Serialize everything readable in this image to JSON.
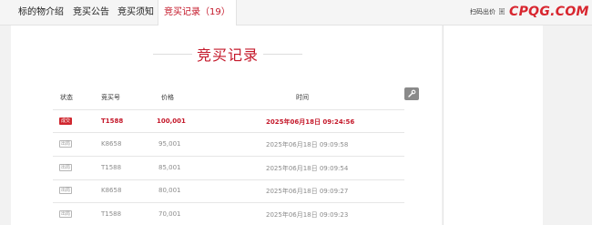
{
  "tabs": [
    {
      "label": "标的物介绍",
      "active": false
    },
    {
      "label": "竞买公告",
      "active": false
    },
    {
      "label": "竞买须知",
      "active": false
    },
    {
      "label": "竞买记录（19）",
      "active": true
    }
  ],
  "header": {
    "scan_text": "扫码出价",
    "qr_icon": "qr-code-icon",
    "brand_logo": "CPQG.COM"
  },
  "section": {
    "title": "竞买记录"
  },
  "settings_icon": "wrench-icon",
  "table": {
    "columns": [
      "状态",
      "竞买号",
      "价格",
      "时间"
    ],
    "rows": [
      {
        "status": "成交",
        "status_type": "winner",
        "bidder": "T1588",
        "price": "100,001",
        "time": "2025年06月18日 09:24:56"
      },
      {
        "status": "出局",
        "status_type": "outbid",
        "bidder": "K8658",
        "price": "95,001",
        "time": "2025年06月18日 09:09:58"
      },
      {
        "status": "出局",
        "status_type": "outbid",
        "bidder": "T1588",
        "price": "85,001",
        "time": "2025年06月18日 09:09:54"
      },
      {
        "status": "出局",
        "status_type": "outbid",
        "bidder": "K8658",
        "price": "80,001",
        "time": "2025年06月18日 09:09:27"
      },
      {
        "status": "出局",
        "status_type": "outbid",
        "bidder": "T1588",
        "price": "70,001",
        "time": "2025年06月18日 09:09:23"
      }
    ]
  },
  "colors": {
    "accent": "#c4182a",
    "brand": "#d8262f",
    "muted_text": "#8c8c8c"
  }
}
